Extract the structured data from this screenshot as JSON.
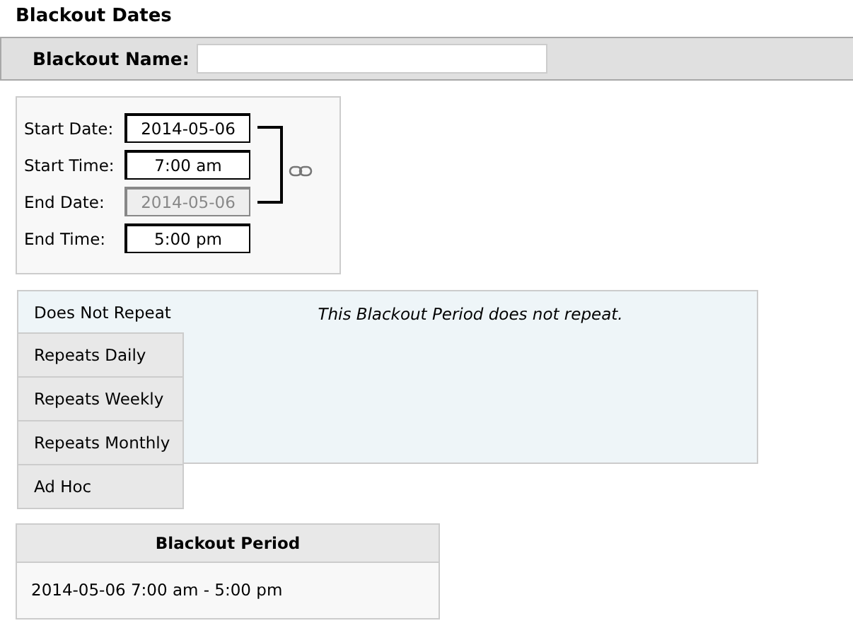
{
  "title": "Blackout Dates",
  "name_field": {
    "label": "Blackout Name:"
  },
  "date_fields": [
    {
      "label": "Start Date:",
      "value": "2014-05-06",
      "disabled": false
    },
    {
      "label": "Start Time:",
      "value": "7:00 am",
      "disabled": false
    },
    {
      "label": "End Date:",
      "value": "2014-05-06",
      "disabled": true
    },
    {
      "label": "End Time:",
      "value": "5:00 pm",
      "disabled": false
    }
  ],
  "repeat_tabs": [
    {
      "label": "Does Not Repeat",
      "selected": true
    },
    {
      "label": "Repeats Daily",
      "selected": false
    },
    {
      "label": "Repeats Weekly",
      "selected": false
    },
    {
      "label": "Repeats Monthly",
      "selected": false
    },
    {
      "label": "Ad Hoc",
      "selected": false
    }
  ],
  "repeat_message": "This Blackout Period does not repeat.",
  "period_table": {
    "heading": "Blackout Period",
    "rows": [
      "2014-05-06 7:00 am - 5:00 pm"
    ]
  }
}
